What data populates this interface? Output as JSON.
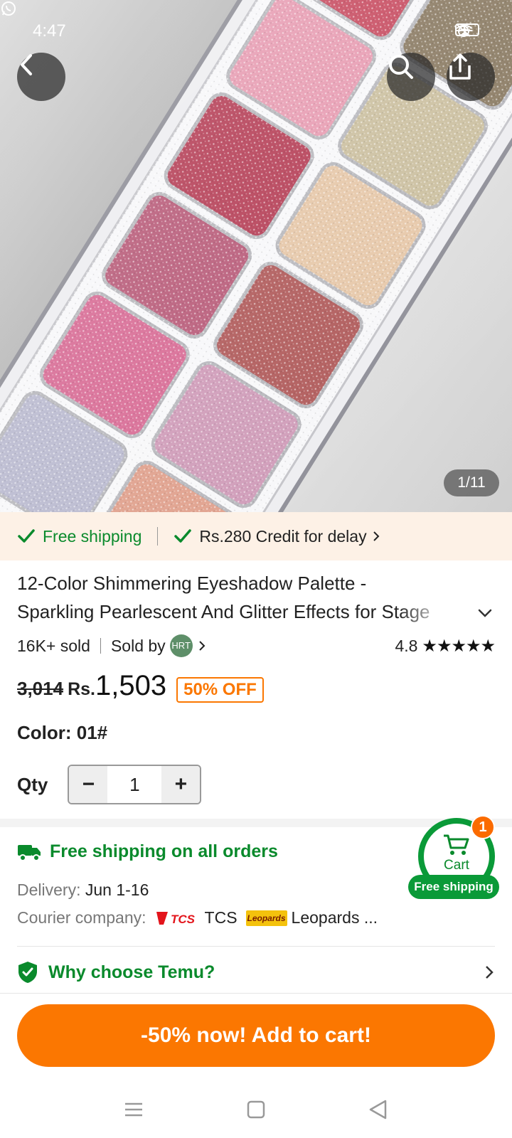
{
  "status_bar": {
    "time": "4:47",
    "battery": "77"
  },
  "gallery": {
    "counter": "1/11"
  },
  "promo": {
    "free_shipping": "Free shipping",
    "credit": "Rs.280 Credit for delay"
  },
  "product": {
    "title": "12-Color Shimmering Eyeshadow Palette - Sparkling Pearlescent And Glitter Effects for Stage",
    "sold": "16K+ sold",
    "sold_by": "Sold by",
    "seller_initials": "HRT",
    "rating": "4.8",
    "stars": "★★★★★",
    "old_price": "3,014",
    "currency": "Rs.",
    "price": "1,503",
    "discount": "50% OFF",
    "color_label": "Color: 01#",
    "qty_label": "Qty",
    "qty_value": "1",
    "qty_minus": "−",
    "qty_plus": "+"
  },
  "shipping": {
    "headline": "Free shipping on all orders",
    "delivery_label": "Delivery:",
    "delivery_value": "Jun 1-16",
    "courier_label": "Courier company:",
    "courier_1": "TCS",
    "courier_2_logo": "Leopards",
    "courier_2": "Leopards ..."
  },
  "why": {
    "label": "Why choose Temu?"
  },
  "cart_float": {
    "label": "Cart",
    "count": "1",
    "badge": "Free shipping"
  },
  "cta": {
    "label": "-50% now! Add to cart!"
  },
  "colors": {
    "accent": "#fb7701",
    "green": "#0a8a2c",
    "promo_bg": "#fdf1e6"
  },
  "icons": [
    "back-icon",
    "search-icon",
    "share-icon",
    "whatsapp-icon",
    "check-icon",
    "chevron-right-icon",
    "chevron-down-icon",
    "truck-icon",
    "shield-check-icon",
    "cart-icon",
    "menu-icon",
    "home-icon",
    "nav-back-icon"
  ]
}
